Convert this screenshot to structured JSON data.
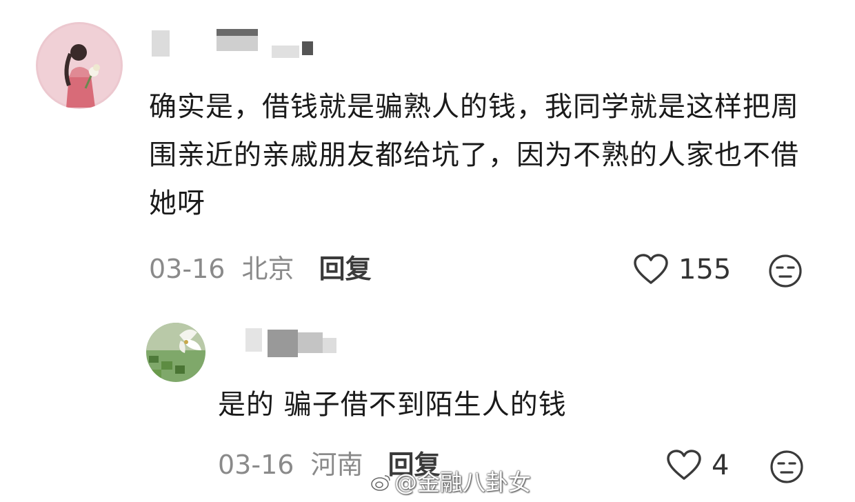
{
  "comments": [
    {
      "text": "确实是，借钱就是骗熟人的钱，我同学就是这样把周围亲近的亲戚朋友都给坑了，因为不熟的人家也不借她呀",
      "date": "03-16",
      "location": "北京",
      "reply_label": "回复",
      "likes": "155",
      "avatar_icon": "girl-with-flowers-avatar"
    },
    {
      "text": "是的 骗子借不到陌生人的钱",
      "date": "03-16",
      "location": "河南",
      "reply_label": "回复",
      "likes": "4",
      "avatar_icon": "lily-flower-avatar"
    }
  ],
  "watermark": {
    "text": "@金融八卦女"
  },
  "colors": {
    "meta": "#8a8a8a",
    "text": "#1a1a1a",
    "icon": "#3a3a3a"
  }
}
